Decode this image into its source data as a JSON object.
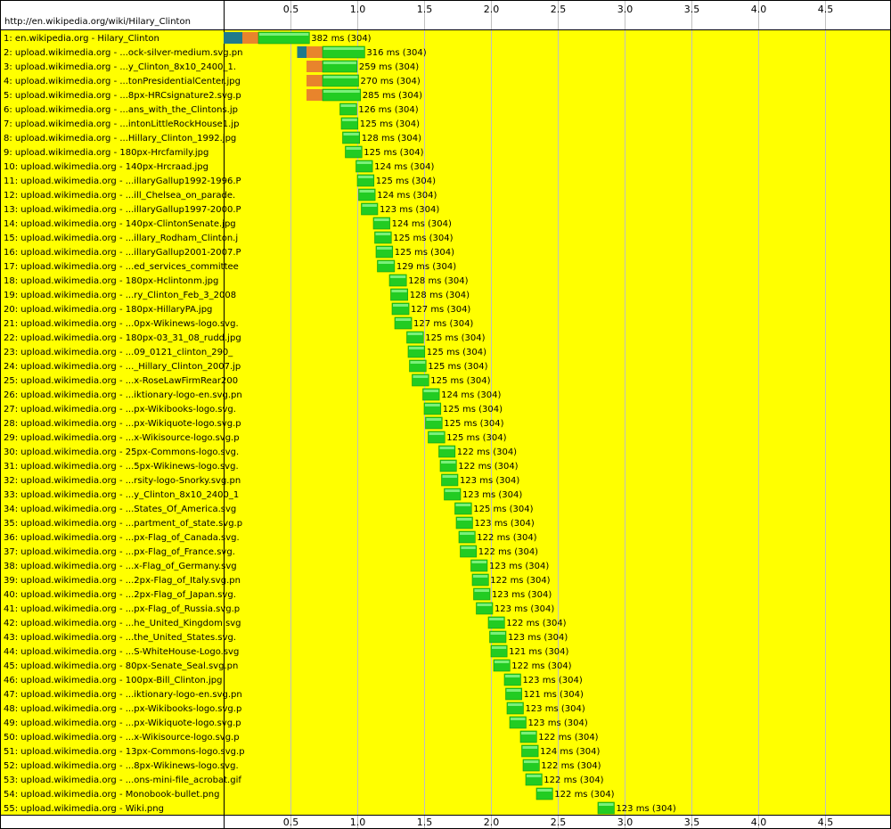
{
  "page_url": "http://en.wikipedia.org/wiki/Hilary_Clinton",
  "chart_data": {
    "type": "bar",
    "title": "",
    "xlabel": "",
    "ylabel": "",
    "xlim": [
      0,
      5.0
    ],
    "x_ticks": [
      "0.5",
      "1.0",
      "1.5",
      "2.0",
      "2.5",
      "3.0",
      "3.5",
      "4.0",
      "4.5"
    ],
    "grid": true,
    "colors": {
      "row_background": "#ffff00",
      "dns": "#1f7a8c",
      "connect": "#e8842c",
      "download": "#22cc22",
      "gridline": "#c0c0c0"
    },
    "rows": [
      {
        "label": "1: en.wikipedia.org - Hilary_Clinton",
        "start": 0.0,
        "dns": 0.14,
        "connect": 0.12,
        "ms": 382,
        "text": "382 ms (304)"
      },
      {
        "label": "2: upload.wikimedia.org - ...ock-silver-medium.svg.pn",
        "start": 0.55,
        "dns": 0.07,
        "connect": 0.12,
        "ms": 316,
        "text": "316 ms (304)"
      },
      {
        "label": "3: upload.wikimedia.org - ...y_Clinton_8x10_2400_1.",
        "start": 0.62,
        "dns": 0.0,
        "connect": 0.12,
        "ms": 259,
        "text": "259 ms (304)"
      },
      {
        "label": "4: upload.wikimedia.org - ...tonPresidentialCenter.jpg",
        "start": 0.62,
        "dns": 0.0,
        "connect": 0.12,
        "ms": 270,
        "text": "270 ms (304)"
      },
      {
        "label": "5: upload.wikimedia.org - ...8px-HRCsignature2.svg.p",
        "start": 0.62,
        "dns": 0.0,
        "connect": 0.12,
        "ms": 285,
        "text": "285 ms (304)"
      },
      {
        "label": "6: upload.wikimedia.org - ...ans_with_the_Clintons.jp",
        "start": 0.87,
        "dns": 0.0,
        "connect": 0.0,
        "ms": 126,
        "text": "126 ms (304)"
      },
      {
        "label": "7: upload.wikimedia.org - ...intonLittleRockHouse1.jp",
        "start": 0.88,
        "dns": 0.0,
        "connect": 0.0,
        "ms": 125,
        "text": "125 ms (304)"
      },
      {
        "label": "8: upload.wikimedia.org - ...Hillary_Clinton_1992.jpg",
        "start": 0.89,
        "dns": 0.0,
        "connect": 0.0,
        "ms": 128,
        "text": "128 ms (304)"
      },
      {
        "label": "9: upload.wikimedia.org - 180px-Hrcfamily.jpg",
        "start": 0.91,
        "dns": 0.0,
        "connect": 0.0,
        "ms": 125,
        "text": "125 ms (304)"
      },
      {
        "label": "10: upload.wikimedia.org - 140px-Hrcraad.jpg",
        "start": 0.99,
        "dns": 0.0,
        "connect": 0.0,
        "ms": 124,
        "text": "124 ms (304)"
      },
      {
        "label": "11: upload.wikimedia.org - ...illaryGallup1992-1996.P",
        "start": 1.0,
        "dns": 0.0,
        "connect": 0.0,
        "ms": 125,
        "text": "125 ms (304)"
      },
      {
        "label": "12: upload.wikimedia.org - ...ill_Chelsea_on_parade.",
        "start": 1.01,
        "dns": 0.0,
        "connect": 0.0,
        "ms": 124,
        "text": "124 ms (304)"
      },
      {
        "label": "13: upload.wikimedia.org - ...illaryGallup1997-2000.P",
        "start": 1.03,
        "dns": 0.0,
        "connect": 0.0,
        "ms": 123,
        "text": "123 ms (304)"
      },
      {
        "label": "14: upload.wikimedia.org - 140px-ClintonSenate.jpg",
        "start": 1.12,
        "dns": 0.0,
        "connect": 0.0,
        "ms": 124,
        "text": "124 ms (304)"
      },
      {
        "label": "15: upload.wikimedia.org - ...illary_Rodham_Clinton.j",
        "start": 1.13,
        "dns": 0.0,
        "connect": 0.0,
        "ms": 125,
        "text": "125 ms (304)"
      },
      {
        "label": "16: upload.wikimedia.org - ...illaryGallup2001-2007.P",
        "start": 1.14,
        "dns": 0.0,
        "connect": 0.0,
        "ms": 125,
        "text": "125 ms (304)"
      },
      {
        "label": "17: upload.wikimedia.org - ...ed_services_committee",
        "start": 1.15,
        "dns": 0.0,
        "connect": 0.0,
        "ms": 129,
        "text": "129 ms (304)"
      },
      {
        "label": "18: upload.wikimedia.org - 180px-Hclintonm.jpg",
        "start": 1.24,
        "dns": 0.0,
        "connect": 0.0,
        "ms": 128,
        "text": "128 ms (304)"
      },
      {
        "label": "19: upload.wikimedia.org - ...ry_Clinton_Feb_3_2008",
        "start": 1.25,
        "dns": 0.0,
        "connect": 0.0,
        "ms": 128,
        "text": "128 ms (304)"
      },
      {
        "label": "20: upload.wikimedia.org - 180px-HillaryPA.jpg",
        "start": 1.26,
        "dns": 0.0,
        "connect": 0.0,
        "ms": 127,
        "text": "127 ms (304)"
      },
      {
        "label": "21: upload.wikimedia.org - ...0px-Wikinews-logo.svg.",
        "start": 1.28,
        "dns": 0.0,
        "connect": 0.0,
        "ms": 127,
        "text": "127 ms (304)"
      },
      {
        "label": "22: upload.wikimedia.org - 180px-03_31_08_rudd.jpg",
        "start": 1.37,
        "dns": 0.0,
        "connect": 0.0,
        "ms": 125,
        "text": "125 ms (304)"
      },
      {
        "label": "23: upload.wikimedia.org - ...09_0121_clinton_290_",
        "start": 1.38,
        "dns": 0.0,
        "connect": 0.0,
        "ms": 125,
        "text": "125 ms (304)"
      },
      {
        "label": "24: upload.wikimedia.org - ..._Hillary_Clinton_2007.jp",
        "start": 1.39,
        "dns": 0.0,
        "connect": 0.0,
        "ms": 125,
        "text": "125 ms (304)"
      },
      {
        "label": "25: upload.wikimedia.org - ...x-RoseLawFirmRear200",
        "start": 1.41,
        "dns": 0.0,
        "connect": 0.0,
        "ms": 125,
        "text": "125 ms (304)"
      },
      {
        "label": "26: upload.wikimedia.org - ...iktionary-logo-en.svg.pn",
        "start": 1.49,
        "dns": 0.0,
        "connect": 0.0,
        "ms": 124,
        "text": "124 ms (304)"
      },
      {
        "label": "27: upload.wikimedia.org - ...px-Wikibooks-logo.svg.",
        "start": 1.5,
        "dns": 0.0,
        "connect": 0.0,
        "ms": 125,
        "text": "125 ms (304)"
      },
      {
        "label": "28: upload.wikimedia.org - ...px-Wikiquote-logo.svg.p",
        "start": 1.51,
        "dns": 0.0,
        "connect": 0.0,
        "ms": 125,
        "text": "125 ms (304)"
      },
      {
        "label": "29: upload.wikimedia.org - ...x-Wikisource-logo.svg.p",
        "start": 1.53,
        "dns": 0.0,
        "connect": 0.0,
        "ms": 125,
        "text": "125 ms (304)"
      },
      {
        "label": "30: upload.wikimedia.org - 25px-Commons-logo.svg.",
        "start": 1.61,
        "dns": 0.0,
        "connect": 0.0,
        "ms": 122,
        "text": "122 ms (304)"
      },
      {
        "label": "31: upload.wikimedia.org - ...5px-Wikinews-logo.svg.",
        "start": 1.62,
        "dns": 0.0,
        "connect": 0.0,
        "ms": 122,
        "text": "122 ms (304)"
      },
      {
        "label": "32: upload.wikimedia.org - ...rsity-logo-Snorky.svg.pn",
        "start": 1.63,
        "dns": 0.0,
        "connect": 0.0,
        "ms": 123,
        "text": "123 ms (304)"
      },
      {
        "label": "33: upload.wikimedia.org - ...y_Clinton_8x10_2400_1",
        "start": 1.65,
        "dns": 0.0,
        "connect": 0.0,
        "ms": 123,
        "text": "123 ms (304)"
      },
      {
        "label": "34: upload.wikimedia.org - ...States_Of_America.svg",
        "start": 1.73,
        "dns": 0.0,
        "connect": 0.0,
        "ms": 125,
        "text": "125 ms (304)"
      },
      {
        "label": "35: upload.wikimedia.org - ...partment_of_state.svg.p",
        "start": 1.74,
        "dns": 0.0,
        "connect": 0.0,
        "ms": 123,
        "text": "123 ms (304)"
      },
      {
        "label": "36: upload.wikimedia.org - ...px-Flag_of_Canada.svg.",
        "start": 1.76,
        "dns": 0.0,
        "connect": 0.0,
        "ms": 122,
        "text": "122 ms (304)"
      },
      {
        "label": "37: upload.wikimedia.org - ...px-Flag_of_France.svg.",
        "start": 1.77,
        "dns": 0.0,
        "connect": 0.0,
        "ms": 122,
        "text": "122 ms (304)"
      },
      {
        "label": "38: upload.wikimedia.org - ...x-Flag_of_Germany.svg",
        "start": 1.85,
        "dns": 0.0,
        "connect": 0.0,
        "ms": 123,
        "text": "123 ms (304)"
      },
      {
        "label": "39: upload.wikimedia.org - ...2px-Flag_of_Italy.svg.pn",
        "start": 1.86,
        "dns": 0.0,
        "connect": 0.0,
        "ms": 122,
        "text": "122 ms (304)"
      },
      {
        "label": "40: upload.wikimedia.org - ...2px-Flag_of_Japan.svg.",
        "start": 1.87,
        "dns": 0.0,
        "connect": 0.0,
        "ms": 123,
        "text": "123 ms (304)"
      },
      {
        "label": "41: upload.wikimedia.org - ...px-Flag_of_Russia.svg.p",
        "start": 1.89,
        "dns": 0.0,
        "connect": 0.0,
        "ms": 123,
        "text": "123 ms (304)"
      },
      {
        "label": "42: upload.wikimedia.org - ...he_United_Kingdom.svg",
        "start": 1.98,
        "dns": 0.0,
        "connect": 0.0,
        "ms": 122,
        "text": "122 ms (304)"
      },
      {
        "label": "43: upload.wikimedia.org - ...the_United_States.svg.",
        "start": 1.99,
        "dns": 0.0,
        "connect": 0.0,
        "ms": 123,
        "text": "123 ms (304)"
      },
      {
        "label": "44: upload.wikimedia.org - ...S-WhiteHouse-Logo.svg",
        "start": 2.0,
        "dns": 0.0,
        "connect": 0.0,
        "ms": 121,
        "text": "121 ms (304)"
      },
      {
        "label": "45: upload.wikimedia.org - 80px-Senate_Seal.svg.pn",
        "start": 2.02,
        "dns": 0.0,
        "connect": 0.0,
        "ms": 122,
        "text": "122 ms (304)"
      },
      {
        "label": "46: upload.wikimedia.org - 100px-Bill_Clinton.jpg",
        "start": 2.1,
        "dns": 0.0,
        "connect": 0.0,
        "ms": 123,
        "text": "123 ms (304)"
      },
      {
        "label": "47: upload.wikimedia.org - ...iktionary-logo-en.svg.pn",
        "start": 2.11,
        "dns": 0.0,
        "connect": 0.0,
        "ms": 121,
        "text": "121 ms (304)"
      },
      {
        "label": "48: upload.wikimedia.org - ...px-Wikibooks-logo.svg.p",
        "start": 2.12,
        "dns": 0.0,
        "connect": 0.0,
        "ms": 123,
        "text": "123 ms (304)"
      },
      {
        "label": "49: upload.wikimedia.org - ...px-Wikiquote-logo.svg.p",
        "start": 2.14,
        "dns": 0.0,
        "connect": 0.0,
        "ms": 123,
        "text": "123 ms (304)"
      },
      {
        "label": "50: upload.wikimedia.org - ...x-Wikisource-logo.svg.p",
        "start": 2.22,
        "dns": 0.0,
        "connect": 0.0,
        "ms": 122,
        "text": "122 ms (304)"
      },
      {
        "label": "51: upload.wikimedia.org - 13px-Commons-logo.svg.p",
        "start": 2.23,
        "dns": 0.0,
        "connect": 0.0,
        "ms": 124,
        "text": "124 ms (304)"
      },
      {
        "label": "52: upload.wikimedia.org - ...8px-Wikinews-logo.svg.",
        "start": 2.24,
        "dns": 0.0,
        "connect": 0.0,
        "ms": 122,
        "text": "122 ms (304)"
      },
      {
        "label": "53: upload.wikimedia.org - ...ons-mini-file_acrobat.gif",
        "start": 2.26,
        "dns": 0.0,
        "connect": 0.0,
        "ms": 122,
        "text": "122 ms (304)"
      },
      {
        "label": "54: upload.wikimedia.org - Monobook-bullet.png",
        "start": 2.34,
        "dns": 0.0,
        "connect": 0.0,
        "ms": 122,
        "text": "122 ms (304)"
      },
      {
        "label": "55: upload.wikimedia.org - Wiki.png",
        "start": 2.8,
        "dns": 0.0,
        "connect": 0.0,
        "ms": 123,
        "text": "123 ms (304)"
      }
    ]
  }
}
